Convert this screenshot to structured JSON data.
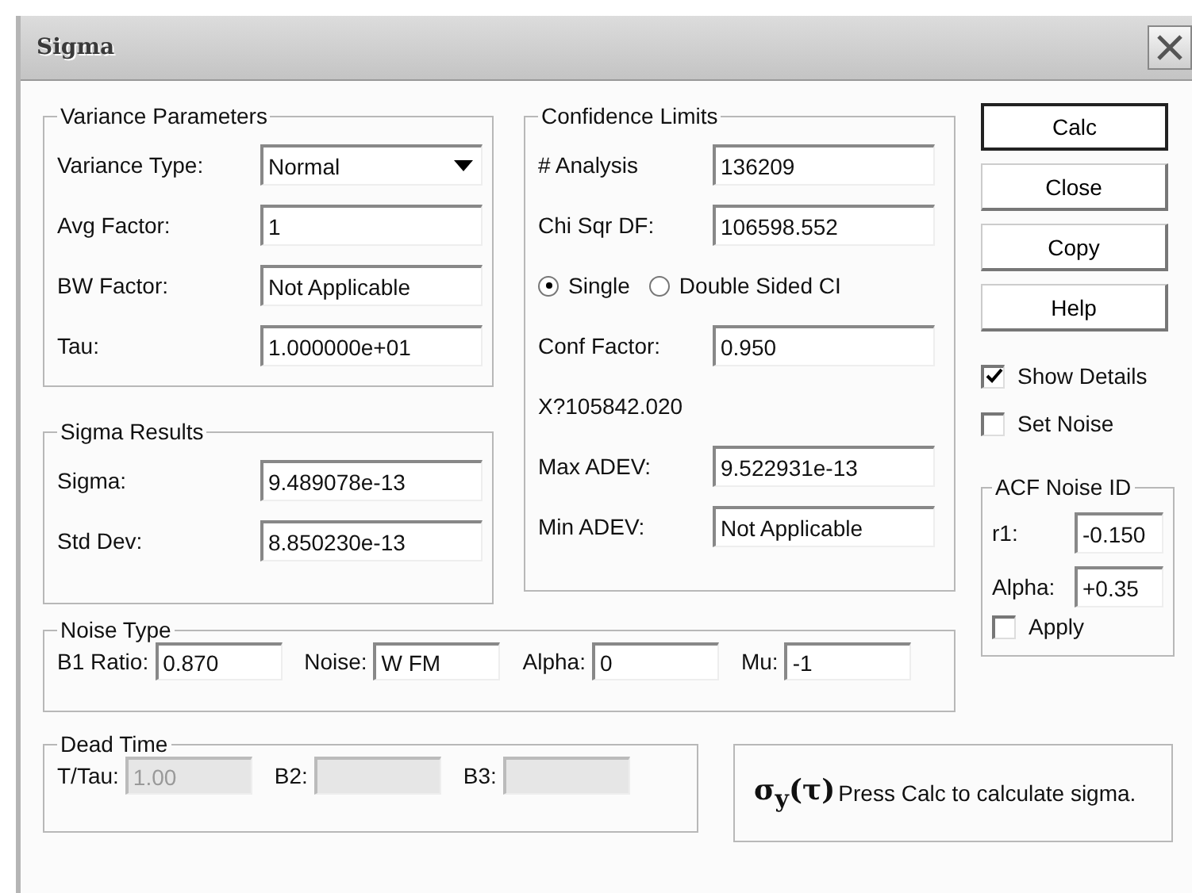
{
  "window": {
    "title": "Sigma"
  },
  "variance_parameters": {
    "title": "Variance Parameters",
    "fields": [
      {
        "label": "Variance Type:",
        "value": "Normal",
        "kind": "dropdown"
      },
      {
        "label": "Avg Factor:",
        "value": "1",
        "kind": "text"
      },
      {
        "label": "BW Factor:",
        "value": "Not Applicable",
        "kind": "text"
      },
      {
        "label": "Tau:",
        "value": "1.000000e+01",
        "kind": "text"
      }
    ]
  },
  "sigma_results": {
    "title": "Sigma Results",
    "fields": [
      {
        "label": "Sigma:",
        "value": "9.489078e-13",
        "kind": "text"
      },
      {
        "label": "Std Dev:",
        "value": "8.850230e-13",
        "kind": "text"
      }
    ]
  },
  "confidence_limits": {
    "title": "Confidence Limits",
    "items": [
      {
        "kind": "field",
        "label": "# Analysis",
        "value": "136209"
      },
      {
        "kind": "field",
        "label": "Chi Sqr DF:",
        "value": "106598.552"
      },
      {
        "kind": "radios",
        "options": [
          {
            "label": "Single",
            "selected": true
          },
          {
            "label": "Double  Sided CI",
            "selected": false
          }
        ]
      },
      {
        "kind": "field",
        "label": "Conf Factor:",
        "value": "0.950"
      },
      {
        "kind": "note",
        "text": "X?105842.020"
      },
      {
        "kind": "field",
        "label": "Max ADEV:",
        "value": "9.522931e-13"
      },
      {
        "kind": "field",
        "label": "Min ADEV:",
        "value": "Not Applicable"
      }
    ]
  },
  "buttons": [
    {
      "label": "Calc",
      "default": true
    },
    {
      "label": "Close",
      "default": false
    },
    {
      "label": "Copy",
      "default": false
    },
    {
      "label": "Help",
      "default": false
    }
  ],
  "options": [
    {
      "label": "Show Details",
      "checked": true
    },
    {
      "label": "Set Noise",
      "checked": false
    }
  ],
  "acf_noise_id": {
    "title": "ACF Noise ID",
    "fields": [
      {
        "label": "r1:",
        "value": "-0.150"
      },
      {
        "label": "Alpha:",
        "value": "+0.35"
      }
    ],
    "apply": {
      "label": "Apply",
      "checked": false
    }
  },
  "noise_type": {
    "title": "Noise Type",
    "fields": [
      {
        "label": "B1 Ratio:",
        "value": "0.870"
      },
      {
        "label": "Noise:",
        "value": "W FM"
      },
      {
        "label": "Alpha:",
        "value": "0"
      },
      {
        "label": "Mu:",
        "value": "-1"
      }
    ]
  },
  "dead_time": {
    "title": "Dead Time",
    "fields": [
      {
        "label": "T/Tau:",
        "value": "1.00",
        "disabled": true
      },
      {
        "label": "B2:",
        "disabled": true
      },
      {
        "label": "B3:",
        "disabled": true
      }
    ]
  },
  "status": {
    "symbol": "σ$_{y}$(τ)",
    "message": "Press Calc to calculate sigma."
  }
}
